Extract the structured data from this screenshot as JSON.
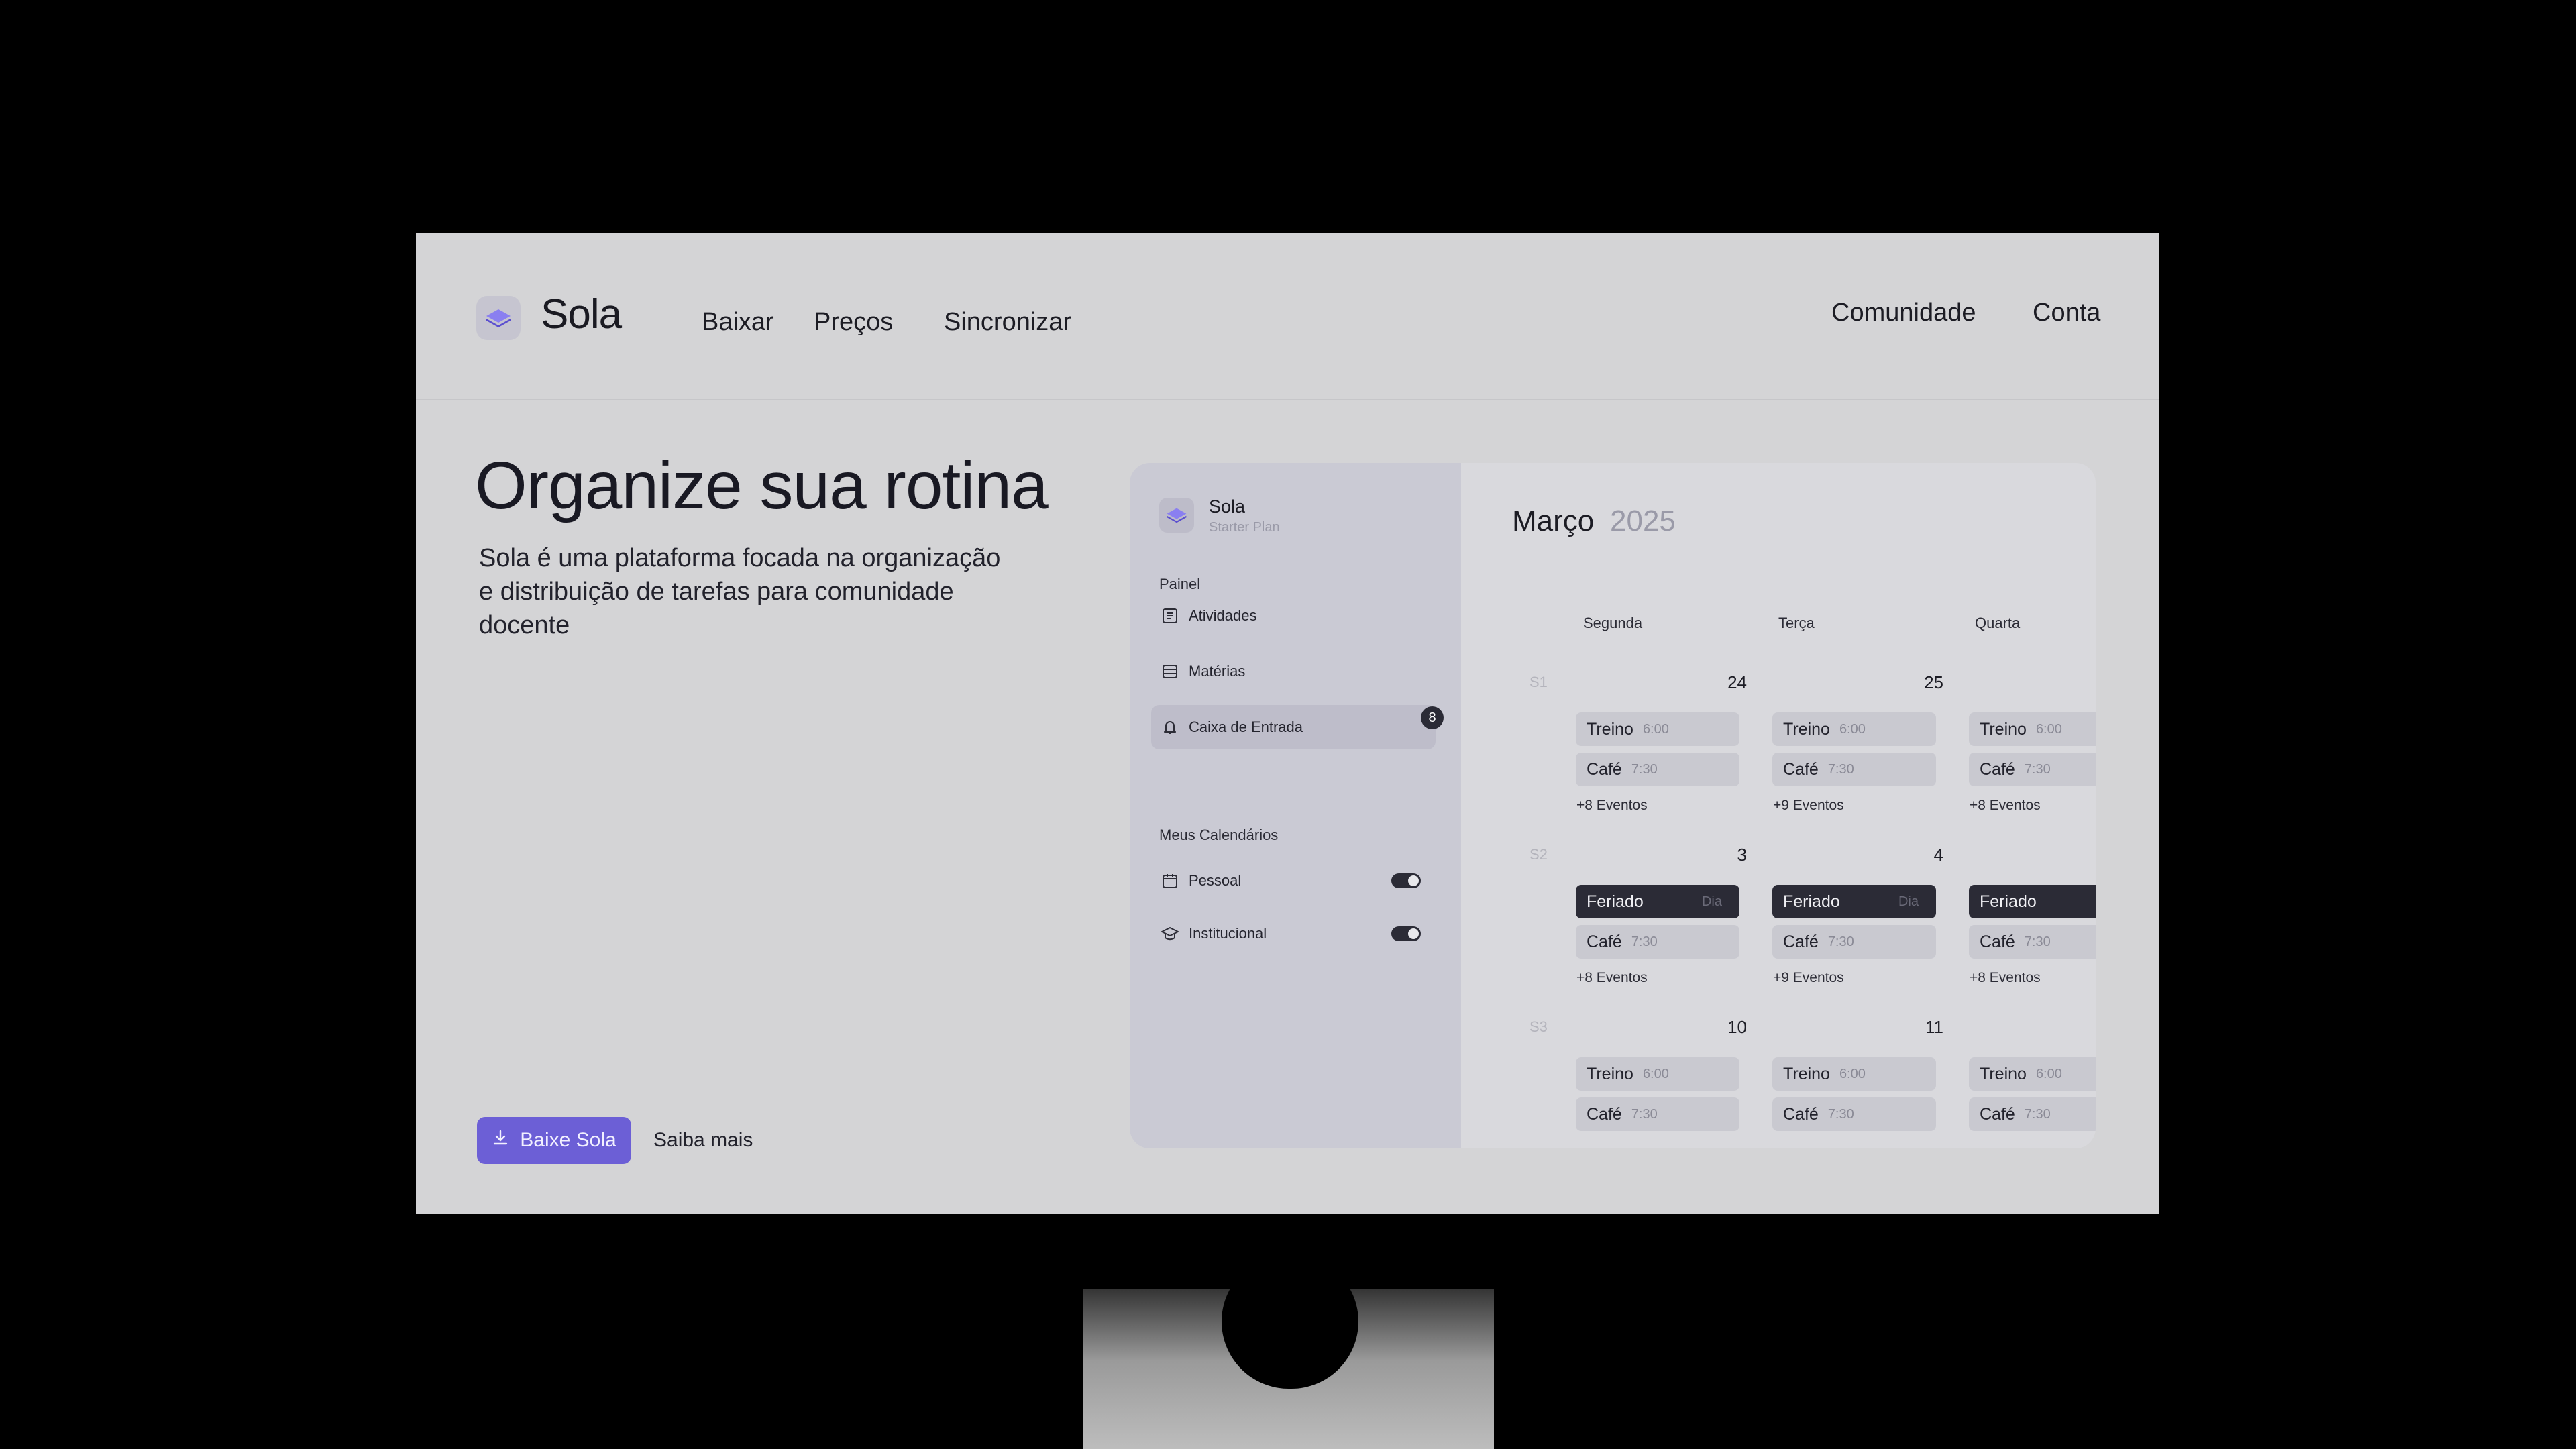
{
  "brand": {
    "name": "Sola",
    "logo_icon": "stack-layers-icon",
    "accent": "#6c5fd6"
  },
  "nav": {
    "left": [
      "Baixar",
      "Preços",
      "Sincronizar"
    ],
    "right": [
      "Comunidade",
      "Conta"
    ]
  },
  "hero": {
    "title": "Organize sua rotina",
    "description": "Sola é uma plataforma focada na organização e distribuição de tarefas para comunidade docente",
    "primary_button": "Baixe Sola",
    "secondary_link": "Saiba mais"
  },
  "app": {
    "sidebar": {
      "name": "Sola",
      "plan": "Starter Plan",
      "panel_label": "Painel",
      "items": [
        {
          "label": "Atividades",
          "icon": "document-list-icon"
        },
        {
          "label": "Matérias",
          "icon": "table-icon"
        },
        {
          "label": "Caixa de Entrada",
          "icon": "bell-icon",
          "badge": "8"
        }
      ],
      "calendars_label": "Meus Calendários",
      "calendars": [
        {
          "label": "Pessoal",
          "icon": "calendar-icon",
          "enabled": true
        },
        {
          "label": "Institucional",
          "icon": "graduation-cap-icon",
          "enabled": true
        }
      ]
    },
    "calendar": {
      "month": "Março",
      "year": "2025",
      "days": [
        "Segunda",
        "Terça",
        "Quarta"
      ],
      "weeks": [
        {
          "label": "S1",
          "dates": [
            "24",
            "25",
            ""
          ],
          "cells": [
            {
              "events": [
                {
                  "title": "Treino",
                  "time": "6:00"
                },
                {
                  "title": "Café",
                  "time": "7:30"
                }
              ],
              "more": "+8 Eventos"
            },
            {
              "events": [
                {
                  "title": "Treino",
                  "time": "6:00"
                },
                {
                  "title": "Café",
                  "time": "7:30"
                }
              ],
              "more": "+9 Eventos"
            },
            {
              "events": [
                {
                  "title": "Treino",
                  "time": "6:00"
                },
                {
                  "title": "Café",
                  "time": "7:30"
                }
              ],
              "more": "+8 Eventos"
            }
          ]
        },
        {
          "label": "S2",
          "dates": [
            "3",
            "4",
            ""
          ],
          "cells": [
            {
              "events": [
                {
                  "title": "Feriado",
                  "time": "Dia"
                },
                {
                  "title": "Café",
                  "time": "7:30"
                }
              ],
              "more": "+8 Eventos"
            },
            {
              "events": [
                {
                  "title": "Feriado",
                  "time": "Dia"
                },
                {
                  "title": "Café",
                  "time": "7:30"
                }
              ],
              "more": "+9 Eventos"
            },
            {
              "events": [
                {
                  "title": "Feriado",
                  "time": ""
                },
                {
                  "title": "Café",
                  "time": "7:30"
                }
              ],
              "more": "+8 Eventos"
            }
          ]
        },
        {
          "label": "S3",
          "dates": [
            "10",
            "11",
            ""
          ],
          "cells": [
            {
              "events": [
                {
                  "title": "Treino",
                  "time": "6:00"
                },
                {
                  "title": "Café",
                  "time": "7:30"
                }
              ],
              "more": ""
            },
            {
              "events": [
                {
                  "title": "Treino",
                  "time": "6:00"
                },
                {
                  "title": "Café",
                  "time": "7:30"
                }
              ],
              "more": ""
            },
            {
              "events": [
                {
                  "title": "Treino",
                  "time": "6:00"
                },
                {
                  "title": "Café",
                  "time": "7:30"
                }
              ],
              "more": ""
            }
          ]
        }
      ]
    }
  }
}
